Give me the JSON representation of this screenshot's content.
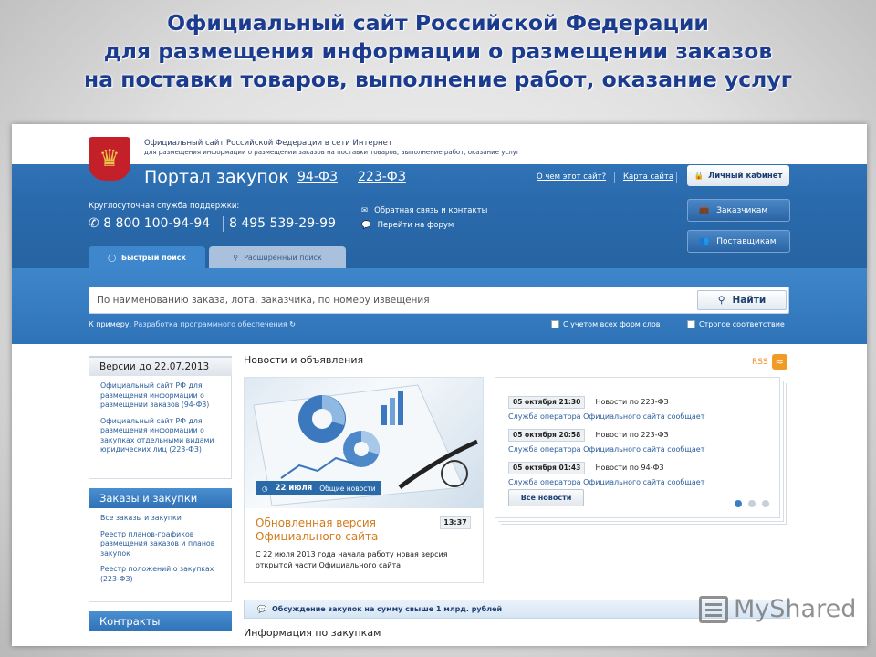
{
  "slide": {
    "title_lines": [
      "Официальный сайт Российской Федерации",
      "для размещения информации о размещении заказов",
      "на поставки товаров, выполнение работ, оказание услуг"
    ]
  },
  "header": {
    "site_name": "Официальный сайт Российской Федерации в сети Интернет",
    "site_sub": "для размещения информации о размещении заказов на поставки товаров, выполнение работ, оказание услуг",
    "portal_title": "Портал закупок",
    "law_94": "94-ФЗ",
    "law_223": "223-ФЗ",
    "about_link": "О чем этот сайт?",
    "map_link": "Карта сайта",
    "cabinet_button": "Личный кабинет"
  },
  "support": {
    "label": "Круглосуточная служба поддержки:",
    "phone1": "8 800 100-94-94",
    "phone2": "8 495 539-29-99",
    "feedback": "Обратная связь и контакты",
    "forum": "Перейти на форум"
  },
  "role_buttons": {
    "customers": "Заказчикам",
    "suppliers": "Поставщикам"
  },
  "tabs": {
    "quick": "Быстрый поиск",
    "advanced": "Расширенный поиск"
  },
  "search": {
    "placeholder": "По наименованию заказа, лота, заказчика, по номеру извещения",
    "button": "Найти",
    "example_prefix": "К примеру,",
    "example_link": "Разработка программного обеспечения",
    "check_all_forms": "С учетом всех форм слов",
    "check_strict": "Строгое соответствие"
  },
  "sidebar": {
    "versions_title": "Версии до 22.07.2013",
    "versions_links": [
      "Официальный сайт РФ для размещения информации о размещении заказов (94-ФЗ)",
      "Официальный сайт РФ для размещения информации о закупках отдельными видами юридических лиц (223-ФЗ)"
    ],
    "orders_title": "Заказы и закупки",
    "orders_links": [
      "Все заказы и закупки",
      "Реестр планов-графиков размещения заказов и планов закупок",
      "Реестр положений о закупках (223-ФЗ)"
    ],
    "contracts_title": "Контракты"
  },
  "news": {
    "title": "Новости и объявления",
    "rss": "RSS",
    "feature": {
      "date": "22 июля",
      "category": "Общие новости",
      "headline": "Обновленная версия Официального сайта",
      "time": "13:37",
      "text": "С 22 июля 2013 года начала работу новая версия открытой части Официального сайта"
    },
    "items": [
      {
        "date": "05 октября 21:30",
        "law": "Новости по 223-ФЗ",
        "link": "Служба оператора Официального сайта сообщает"
      },
      {
        "date": "05 октября 20:58",
        "law": "Новости по 223-ФЗ",
        "link": "Служба оператора Официального сайта сообщает"
      },
      {
        "date": "05 октября 01:43",
        "law": "Новости по 94-ФЗ",
        "link": "Служба оператора Официального сайта сообщает"
      }
    ],
    "all_news": "Все новости"
  },
  "discussion": "Обсуждение закупок на сумму свыше 1 млрд. рублей",
  "info_title": "Информация по закупкам",
  "watermark": "MyShared",
  "colors": {
    "brand_blue": "#2a6aac",
    "title_blue": "#1b3b8f",
    "accent_orange": "#d37b1b"
  }
}
